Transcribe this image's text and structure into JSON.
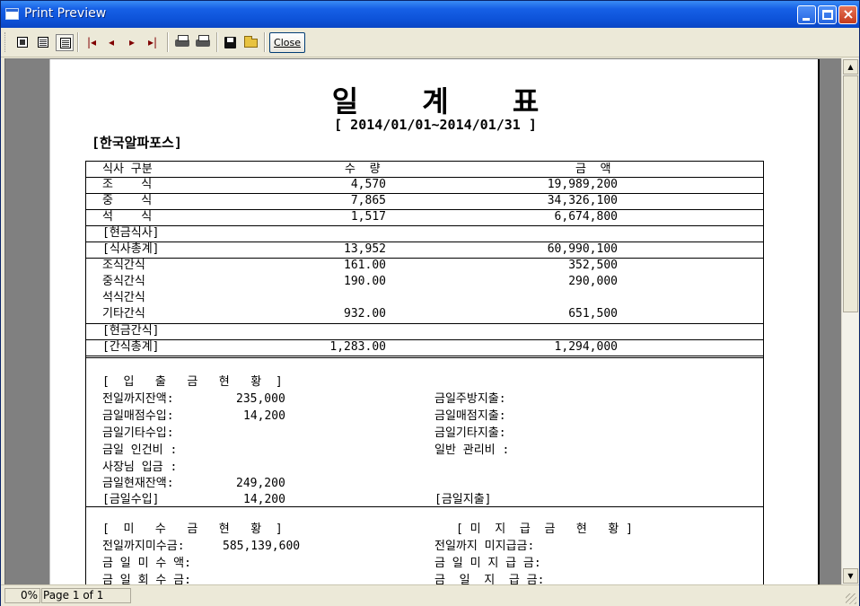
{
  "window": {
    "title": "Print Preview"
  },
  "toolbar": {
    "close_label": "Close"
  },
  "status": {
    "zoom": "0%",
    "page": "Page 1 of 1"
  },
  "report": {
    "title": "일 계 표",
    "period": "[ 2014/01/01~2014/01/31 ]",
    "company": "[한국알파포스]",
    "header": {
      "c1": "식사 구분",
      "c2": "수  량",
      "c3": "금  액"
    },
    "rows": [
      {
        "c1": "조    식",
        "c2": "4,570",
        "c3": "19,989,200"
      },
      {
        "c1": "중    식",
        "c2": "7,865",
        "c3": "34,326,100"
      },
      {
        "c1": "석    식",
        "c2": "1,517",
        "c3": "6,674,800"
      },
      {
        "c1": "[현금식사]",
        "c2": "",
        "c3": ""
      },
      {
        "c1": "[식사총계]",
        "c2": "13,952",
        "c3": "60,990,100"
      },
      {
        "c1": "조식간식",
        "c2": "161.00",
        "c3": "352,500"
      },
      {
        "c1": "중식간식",
        "c2": "190.00",
        "c3": "290,000"
      },
      {
        "c1": "석식간식",
        "c2": "",
        "c3": ""
      },
      {
        "c1": "기타간식",
        "c2": "932.00",
        "c3": "651,500"
      },
      {
        "c1": "[현금간식]",
        "c2": "",
        "c3": ""
      },
      {
        "c1": "[간식총계]",
        "c2": "1,283.00",
        "c3": "1,294,000"
      }
    ],
    "cash": {
      "heading": "[  입   출   금   현   황  ]",
      "left": [
        {
          "label": "전일까지잔액:",
          "value": "235,000"
        },
        {
          "label": "금일매점수입:",
          "value": "14,200"
        },
        {
          "label": "금일기타수입:",
          "value": ""
        },
        {
          "label": "금일 인건비 :",
          "value": ""
        },
        {
          "label": "사장님 입금 :",
          "value": ""
        },
        {
          "label": "금일현재잔액:",
          "value": "249,200"
        },
        {
          "label": "[금일수입]",
          "value": "14,200"
        }
      ],
      "right": [
        "금일주방지출:",
        "금일매점지출:",
        "금일기타지출:",
        "일반 관리비 :",
        "",
        "",
        "[금일지출]"
      ]
    },
    "receivable": {
      "heading_left": "[  미   수   금   현   황  ]",
      "heading_right": "[ 미  지  급  금   현   황 ]",
      "left": [
        {
          "label": "전일까지미수금:",
          "value": "585,139,600"
        },
        {
          "label": "금 일 미 수 액:",
          "value": ""
        },
        {
          "label": "금 일 회 수 금:",
          "value": ""
        }
      ],
      "right": [
        "전일까지 미지급금:",
        "금 일 미 지 급 금:",
        "금  일  지  급 금:"
      ]
    }
  }
}
